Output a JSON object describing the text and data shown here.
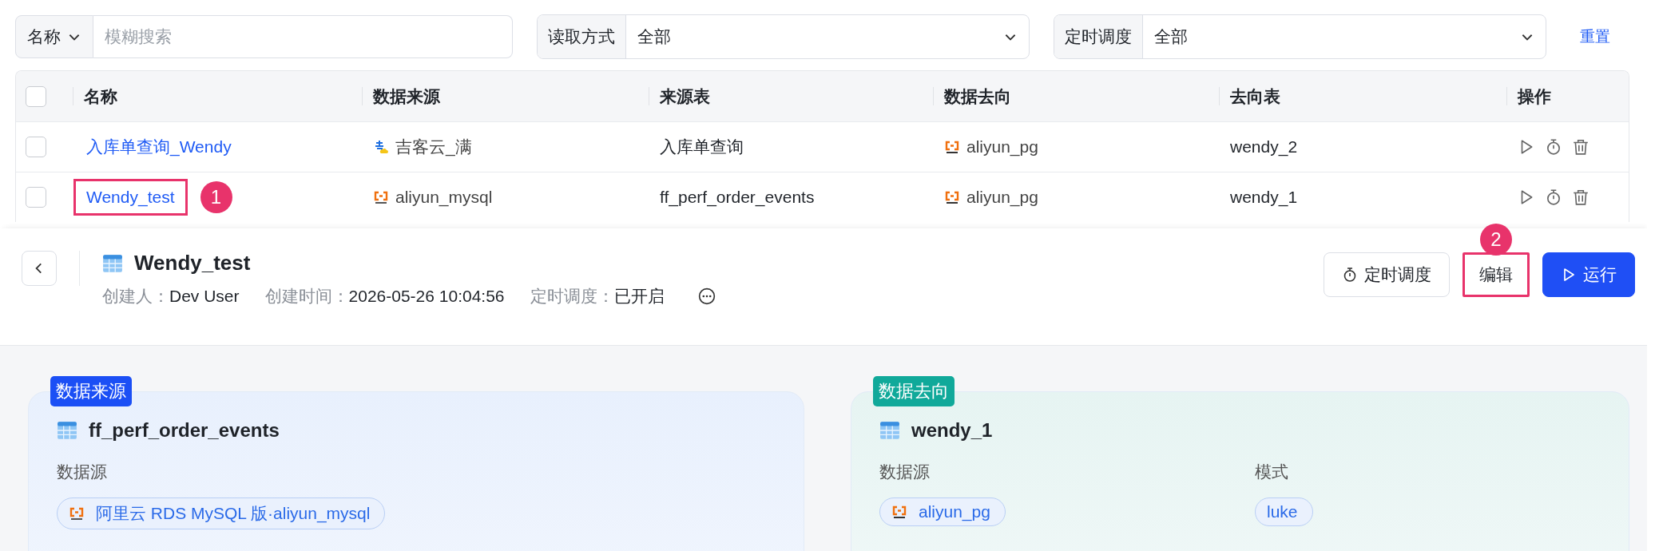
{
  "filters": {
    "name_filter": {
      "field": "名称",
      "placeholder": "模糊搜索"
    },
    "selects": [
      {
        "label": "读取方式",
        "value": "全部"
      },
      {
        "label": "定时调度",
        "value": "全部"
      }
    ],
    "reset": "重置"
  },
  "table": {
    "header_checked": false,
    "columns": [
      "名称",
      "数据来源",
      "来源表",
      "数据去向",
      "去向表",
      "操作"
    ],
    "rows": [
      {
        "checked": false,
        "name": "入库单查询_Wendy",
        "highlight": false,
        "source": {
          "kind": "jike",
          "name": "吉客云_满"
        },
        "source_table": "入库单查询",
        "target": {
          "kind": "postgresql",
          "name": "aliyun_pg"
        },
        "target_table": "wendy_2"
      },
      {
        "checked": false,
        "name": "Wendy_test",
        "highlight": true,
        "marker": "1",
        "source": {
          "kind": "mysql",
          "name": "aliyun_mysql"
        },
        "source_table": "ff_perf_order_events",
        "target": {
          "kind": "postgresql",
          "name": "aliyun_pg"
        },
        "target_table": "wendy_1"
      }
    ]
  },
  "detail": {
    "title": "Wendy_test",
    "meta": [
      {
        "label": "创建人：",
        "value": "Dev User"
      },
      {
        "label": "创建时间：",
        "value": "2026-05-26 10:04:56"
      },
      {
        "label": "定时调度：",
        "value": "已开启"
      }
    ],
    "buttons": [
      {
        "kind": "schedule",
        "label": "定时调度",
        "highlight": false
      },
      {
        "kind": "edit",
        "label": "编辑",
        "highlight": true,
        "marker": "2"
      },
      {
        "kind": "run",
        "label": "运行",
        "highlight": false
      }
    ],
    "cards": [
      {
        "kind": "source",
        "tag": "数据来源",
        "color": "#1b4ff5",
        "title": "ff_perf_order_events",
        "fields": [
          {
            "label": "数据源",
            "kind": "mysql",
            "value": "阿里云 RDS MySQL 版·aliyun_mysql"
          }
        ]
      },
      {
        "kind": "target",
        "tag": "数据去向",
        "color": "#10a99a",
        "title": "wendy_1",
        "fields": [
          {
            "label": "数据源",
            "kind": "postgresql",
            "value": "aliyun_pg"
          },
          {
            "label": "模式",
            "kind": "plain",
            "value": "luke"
          }
        ]
      }
    ]
  }
}
